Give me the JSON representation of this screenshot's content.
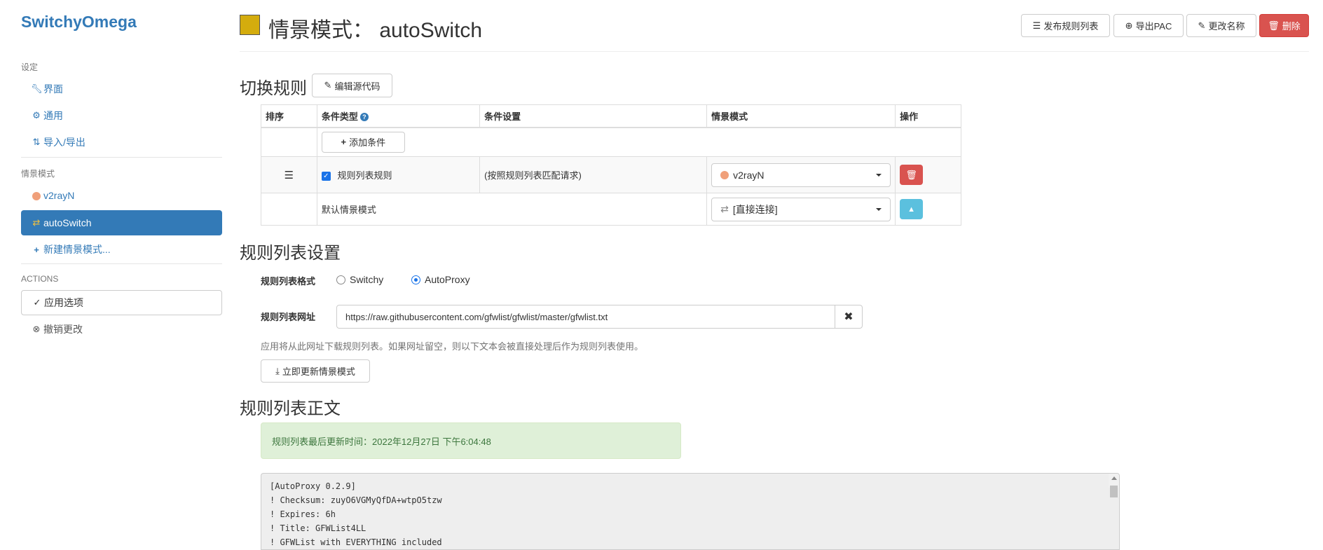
{
  "app": {
    "brand": "SwitchyOmega"
  },
  "sidebar": {
    "settings_header": "设定",
    "settings_items": [
      {
        "label": "界面",
        "icon": "wrench-icon"
      },
      {
        "label": "通用",
        "icon": "gear-icon"
      },
      {
        "label": "导入/导出",
        "icon": "import-export-icon"
      }
    ],
    "profiles_header": "情景模式",
    "profiles": [
      {
        "label": "v2rayN",
        "icon": "globe-icon"
      },
      {
        "label": "autoSwitch",
        "icon": "switch-icon",
        "active": true
      },
      {
        "label": "新建情景模式...",
        "icon": "plus-icon"
      }
    ],
    "actions_header": "ACTIONS",
    "actions": [
      {
        "label": "应用选项",
        "icon": "check-circle-icon"
      },
      {
        "label": "撤销更改",
        "icon": "x-circle-icon"
      }
    ]
  },
  "header": {
    "title": "情景模式： autoSwitch",
    "profile_color": "#d4ac0d",
    "buttons": {
      "publish": "发布规则列表",
      "export_pac": "导出PAC",
      "rename": "更改名称",
      "delete": "删除"
    }
  },
  "switch_rules": {
    "heading": "切换规则",
    "edit_source_button": "编辑源代码",
    "columns": [
      "排序",
      "条件类型",
      "条件设置",
      "情景模式",
      "操作"
    ],
    "add_condition_button": "添加条件",
    "rule_row": {
      "condition_type": "规则列表规则",
      "checked": true,
      "condition_setting": "(按照规则列表匹配请求)",
      "profile": "v2rayN"
    },
    "default_row": {
      "label": "默认情景模式",
      "profile": "[直接连接]"
    }
  },
  "rule_list_settings": {
    "heading": "规则列表设置",
    "format_label": "规则列表格式",
    "format_options": [
      {
        "label": "Switchy",
        "selected": false
      },
      {
        "label": "AutoProxy",
        "selected": true
      }
    ],
    "url_label": "规则列表网址",
    "url_value": "https://raw.githubusercontent.com/gfwlist/gfwlist/master/gfwlist.txt",
    "help_text": "应用将从此网址下载规则列表。如果网址留空，则以下文本会被直接处理后作为规则列表使用。",
    "update_button": "立即更新情景模式"
  },
  "rule_list_text": {
    "heading": "规则列表正文",
    "last_updated": "规则列表最后更新时间：2022年12月27日 下午6:04:48",
    "lines": [
      "[AutoProxy 0.2.9]",
      "! Checksum: zuyO6VGMyQfDA+wtpO5tzw",
      "! Expires: 6h",
      "! Title: GFWList4LL",
      "! GFWList with EVERYTHING included"
    ]
  },
  "colors": {
    "primary": "#337ab7",
    "danger": "#d9534f",
    "info": "#5bc0de",
    "success_bg": "#dff0d8",
    "success_text": "#3c763d"
  }
}
